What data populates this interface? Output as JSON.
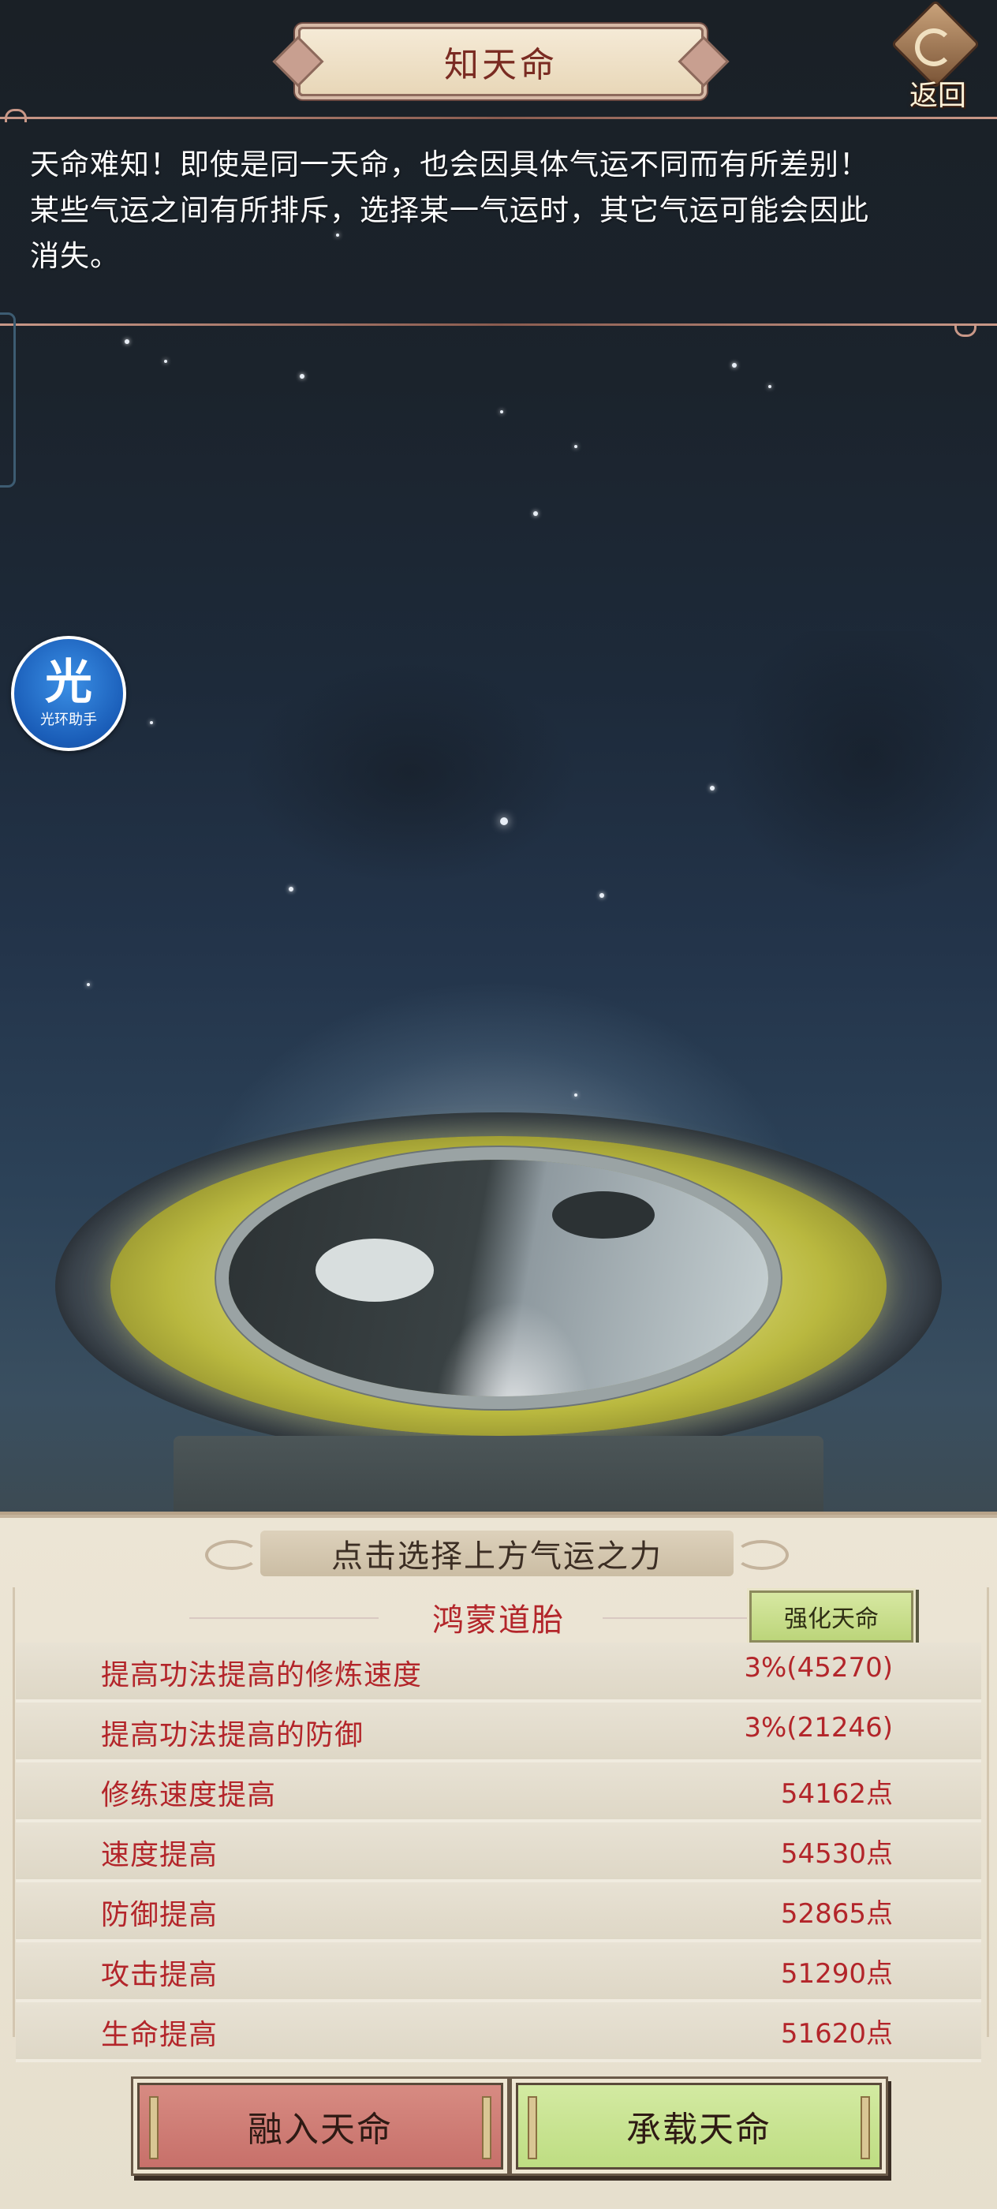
{
  "header": {
    "title": "知天命",
    "back_label": "返回"
  },
  "intro": {
    "line1": "天命难知！即使是同一天命，也会因具体气运不同而有所差别！",
    "line2": "某些气运之间有所排斥，选择某一气运时，其它气运可能会因此",
    "line3": "消失。"
  },
  "assistant": {
    "glyph": "光",
    "label": "光环助手"
  },
  "panel": {
    "heading": "点击选择上方气运之力",
    "fate_name": "鸿蒙道胎",
    "enhance_label": "强化天命",
    "stats": [
      {
        "label": "提高功法提高的修炼速度",
        "value": "3%(45270)"
      },
      {
        "label": "提高功法提高的防御",
        "value": "3%(21246)"
      },
      {
        "label": "修练速度提高",
        "value": "54162点"
      },
      {
        "label": "速度提高",
        "value": "54530点"
      },
      {
        "label": "防御提高",
        "value": "52865点"
      },
      {
        "label": "攻击提高",
        "value": "51290点"
      },
      {
        "label": "生命提高",
        "value": "51620点"
      }
    ],
    "merge_label": "融入天命",
    "bear_label": "承载天命"
  },
  "colors": {
    "accent_red": "#b3252a",
    "merge_button": "#c7706a",
    "bear_button": "#bedd82",
    "panel_bg": "#e6dfcd"
  },
  "icons": {
    "back": "back-arrow-diamond-icon",
    "assistant": "halo-assistant-icon"
  }
}
